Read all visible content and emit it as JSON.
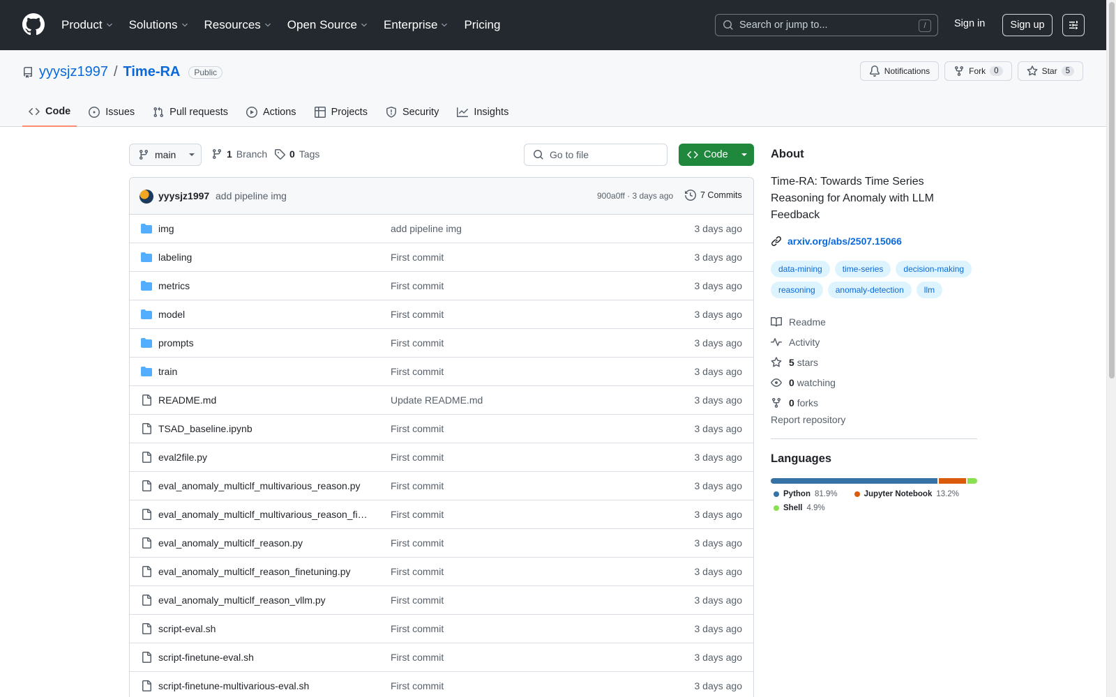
{
  "header": {
    "nav": [
      {
        "label": "Product",
        "has_menu": true
      },
      {
        "label": "Solutions",
        "has_menu": true
      },
      {
        "label": "Resources",
        "has_menu": true
      },
      {
        "label": "Open Source",
        "has_menu": true
      },
      {
        "label": "Enterprise",
        "has_menu": true
      },
      {
        "label": "Pricing",
        "has_menu": false
      }
    ],
    "search_placeholder": "Search or jump to...",
    "search_shortcut": "/",
    "sign_in": "Sign in",
    "sign_up": "Sign up"
  },
  "repo": {
    "owner": "yyysjz1997",
    "separator": "/",
    "name": "Time-RA",
    "visibility": "Public",
    "notifications_label": "Notifications",
    "fork_label": "Fork",
    "fork_count": "0",
    "star_label": "Star",
    "star_count": "5",
    "tabs": [
      {
        "label": "Code",
        "icon": "code-icon",
        "active": true
      },
      {
        "label": "Issues",
        "icon": "issue-icon",
        "active": false
      },
      {
        "label": "Pull requests",
        "icon": "pull-request-icon",
        "active": false
      },
      {
        "label": "Actions",
        "icon": "play-icon",
        "active": false
      },
      {
        "label": "Projects",
        "icon": "table-icon",
        "active": false
      },
      {
        "label": "Security",
        "icon": "shield-icon",
        "active": false
      },
      {
        "label": "Insights",
        "icon": "graph-icon",
        "active": false
      }
    ]
  },
  "toolbar": {
    "branch": "main",
    "branch_count": "1",
    "branch_label": "Branch",
    "tag_count": "0",
    "tag_label": "Tags",
    "goto_file_placeholder": "Go to file",
    "code_button": "Code"
  },
  "latest_commit": {
    "author": "yyysjz1997",
    "message": "add pipeline img",
    "meta": "900a0ff · 3 days ago",
    "commits_label": "7 Commits"
  },
  "files": [
    {
      "name": "img",
      "type": "folder",
      "commit": "add pipeline img",
      "age": "3 days ago"
    },
    {
      "name": "labeling",
      "type": "folder",
      "commit": "First commit",
      "age": "3 days ago"
    },
    {
      "name": "metrics",
      "type": "folder",
      "commit": "First commit",
      "age": "3 days ago"
    },
    {
      "name": "model",
      "type": "folder",
      "commit": "First commit",
      "age": "3 days ago"
    },
    {
      "name": "prompts",
      "type": "folder",
      "commit": "First commit",
      "age": "3 days ago"
    },
    {
      "name": "train",
      "type": "folder",
      "commit": "First commit",
      "age": "3 days ago"
    },
    {
      "name": "README.md",
      "type": "file",
      "commit": "Update README.md",
      "age": "3 days ago"
    },
    {
      "name": "TSAD_baseline.ipynb",
      "type": "file",
      "commit": "First commit",
      "age": "3 days ago"
    },
    {
      "name": "eval2file.py",
      "type": "file",
      "commit": "First commit",
      "age": "3 days ago"
    },
    {
      "name": "eval_anomaly_multiclf_multivarious_reason.py",
      "type": "file",
      "commit": "First commit",
      "age": "3 days ago"
    },
    {
      "name": "eval_anomaly_multiclf_multivarious_reason_fi…",
      "type": "file",
      "commit": "First commit",
      "age": "3 days ago"
    },
    {
      "name": "eval_anomaly_multiclf_reason.py",
      "type": "file",
      "commit": "First commit",
      "age": "3 days ago"
    },
    {
      "name": "eval_anomaly_multiclf_reason_finetuning.py",
      "type": "file",
      "commit": "First commit",
      "age": "3 days ago"
    },
    {
      "name": "eval_anomaly_multiclf_reason_vllm.py",
      "type": "file",
      "commit": "First commit",
      "age": "3 days ago"
    },
    {
      "name": "script-eval.sh",
      "type": "file",
      "commit": "First commit",
      "age": "3 days ago"
    },
    {
      "name": "script-finetune-eval.sh",
      "type": "file",
      "commit": "First commit",
      "age": "3 days ago"
    },
    {
      "name": "script-finetune-multivarious-eval.sh",
      "type": "file",
      "commit": "First commit",
      "age": "3 days ago"
    }
  ],
  "about": {
    "title": "About",
    "description": "Time-RA: Towards Time Series Reasoning for Anomaly with LLM Feedback",
    "link": "arxiv.org/abs/2507.15066",
    "topics": [
      "data-mining",
      "time-series",
      "decision-making",
      "reasoning",
      "anomaly-detection",
      "llm"
    ],
    "readme": "Readme",
    "activity": "Activity",
    "stars_count": "5",
    "stars_label": "stars",
    "watching_count": "0",
    "watching_label": "watching",
    "forks_count": "0",
    "forks_label": "forks",
    "report": "Report repository"
  },
  "languages": {
    "title": "Languages",
    "items": [
      {
        "name": "Python",
        "percent": "81.9%",
        "value": 81.9,
        "color": "#3572A5"
      },
      {
        "name": "Jupyter Notebook",
        "percent": "13.2%",
        "value": 13.2,
        "color": "#DA5B0B"
      },
      {
        "name": "Shell",
        "percent": "4.9%",
        "value": 4.9,
        "color": "#89e051"
      }
    ]
  }
}
